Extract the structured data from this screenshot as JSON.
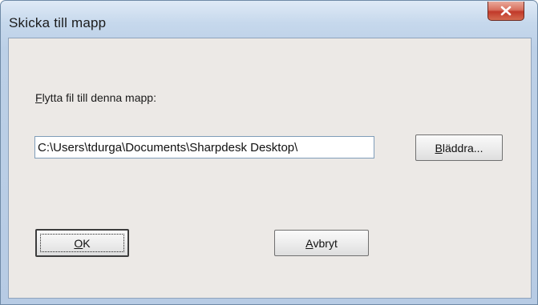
{
  "window": {
    "title": "Skicka till mapp",
    "close_icon": "close-icon"
  },
  "dialog": {
    "label_accel": "F",
    "label_rest": "lytta fil till denna mapp:",
    "path_value": "C:\\Users\\tdurga\\Documents\\Sharpdesk Desktop\\",
    "browse": {
      "accel": "B",
      "rest": "läddra..."
    },
    "ok": {
      "accel": "O",
      "rest": "K"
    },
    "cancel": {
      "accel": "A",
      "rest": "vbryt"
    }
  },
  "colors": {
    "close_button": "#c1392a",
    "client_background": "#ece9e6",
    "frame": "#bcd0e7"
  }
}
